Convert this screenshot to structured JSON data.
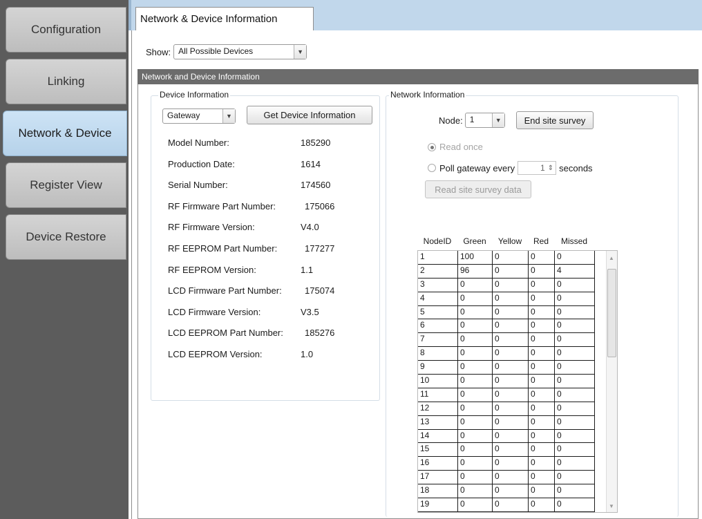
{
  "sidebar": {
    "items": [
      {
        "label": "Configuration"
      },
      {
        "label": "Linking"
      },
      {
        "label": "Network & Device",
        "active": true
      },
      {
        "label": "Register View"
      },
      {
        "label": "Device Restore"
      }
    ]
  },
  "tab": {
    "label": "Network & Device Information"
  },
  "show": {
    "label": "Show:",
    "value": "All Possible Devices"
  },
  "section": {
    "title": "Network and Device Information"
  },
  "device_info": {
    "title": "Device Information",
    "device_select": "Gateway",
    "get_button": "Get Device Information",
    "rows": [
      {
        "label": "Model Number:",
        "value": "185290"
      },
      {
        "label": "Production Date:",
        "value": "1614"
      },
      {
        "label": "Serial Number:",
        "value": "174560"
      },
      {
        "label": "RF Firmware Part Number:",
        "value": "175066"
      },
      {
        "label": "RF Firmware Version:",
        "value": "V4.0"
      },
      {
        "label": "RF EEPROM Part Number:",
        "value": "177277"
      },
      {
        "label": "RF EEPROM Version:",
        "value": "1.1"
      },
      {
        "label": "LCD Firmware Part Number:",
        "value": "175074"
      },
      {
        "label": "LCD Firmware Version:",
        "value": "V3.5"
      },
      {
        "label": "LCD EEPROM Part Number:",
        "value": "185276"
      },
      {
        "label": "LCD EEPROM Version:",
        "value": "1.0"
      }
    ]
  },
  "network_info": {
    "title": "Network Information",
    "node_label": "Node:",
    "node_value": "1",
    "end_survey_button": "End site survey",
    "read_once": "Read once",
    "poll_label": "Poll gateway every",
    "poll_value": "1",
    "poll_unit": "seconds",
    "read_data_button": "Read site survey data",
    "table": {
      "headers": [
        "NodeID",
        "Green",
        "Yellow",
        "Red",
        "Missed"
      ],
      "rows": [
        [
          "1",
          "100",
          "0",
          "0",
          "0"
        ],
        [
          "2",
          "96",
          "0",
          "0",
          "4"
        ],
        [
          "3",
          "0",
          "0",
          "0",
          "0"
        ],
        [
          "4",
          "0",
          "0",
          "0",
          "0"
        ],
        [
          "5",
          "0",
          "0",
          "0",
          "0"
        ],
        [
          "6",
          "0",
          "0",
          "0",
          "0"
        ],
        [
          "7",
          "0",
          "0",
          "0",
          "0"
        ],
        [
          "8",
          "0",
          "0",
          "0",
          "0"
        ],
        [
          "9",
          "0",
          "0",
          "0",
          "0"
        ],
        [
          "10",
          "0",
          "0",
          "0",
          "0"
        ],
        [
          "11",
          "0",
          "0",
          "0",
          "0"
        ],
        [
          "12",
          "0",
          "0",
          "0",
          "0"
        ],
        [
          "13",
          "0",
          "0",
          "0",
          "0"
        ],
        [
          "14",
          "0",
          "0",
          "0",
          "0"
        ],
        [
          "15",
          "0",
          "0",
          "0",
          "0"
        ],
        [
          "16",
          "0",
          "0",
          "0",
          "0"
        ],
        [
          "17",
          "0",
          "0",
          "0",
          "0"
        ],
        [
          "18",
          "0",
          "0",
          "0",
          "0"
        ],
        [
          "19",
          "0",
          "0",
          "0",
          "0"
        ]
      ]
    }
  }
}
